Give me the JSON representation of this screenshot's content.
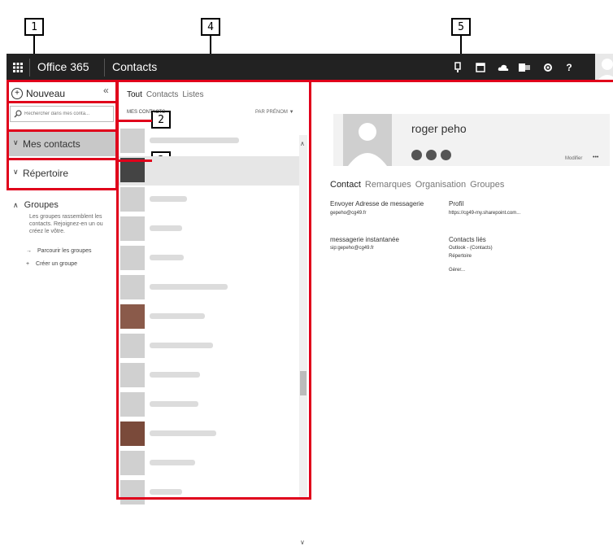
{
  "callouts": [
    "1",
    "2",
    "3",
    "4",
    "5"
  ],
  "topbar": {
    "apps_icon": "waffle-icon",
    "app_name": "Office 365",
    "section": "Contacts",
    "icons": [
      "notifications-icon",
      "calendar-icon",
      "onedrive-icon",
      "outlook-icon",
      "gear-icon",
      "help-icon",
      "avatar-icon"
    ],
    "help_label": "?"
  },
  "leftnav": {
    "new_label": "Nouveau",
    "collapse_label": "«",
    "search_placeholder": "Rechercher dans mes conta...",
    "my_contacts": "Mes contacts",
    "directory": "Répertoire",
    "groups_title": "Groupes",
    "groups_desc": "Les groupes rassemblent les contacts. Rejoignez-en un ou créez le vôtre.",
    "browse_groups": "Parcourir les groupes",
    "create_group": "Créer un groupe"
  },
  "list": {
    "tabs": [
      "Tout",
      "Contacts",
      "Listes"
    ],
    "section_label": "MES CONTACTS",
    "sort_label": "PAR PRÉNOM",
    "rows": 15
  },
  "contact": {
    "name": "roger peho",
    "modify_label": "Modifier",
    "more_label": "•••",
    "tabs": [
      "Contact",
      "Remarques",
      "Organisation",
      "Groupes"
    ],
    "email_label": "Envoyer Adresse de messagerie",
    "email_value": "gepeho@cg49.fr",
    "im_label": "messagerie instantanée",
    "im_value": "sip:gepeho@cg49.fr",
    "profile_label": "Profil",
    "profile_value": "https://cg49-my.sharepoint.com...",
    "linked_label": "Contacts liés",
    "linked_items": [
      "Outlook - (Contacts)",
      "Répertoire",
      "Gérer..."
    ]
  },
  "colors": {
    "accent": "#e0001b",
    "topbar": "#222222"
  }
}
